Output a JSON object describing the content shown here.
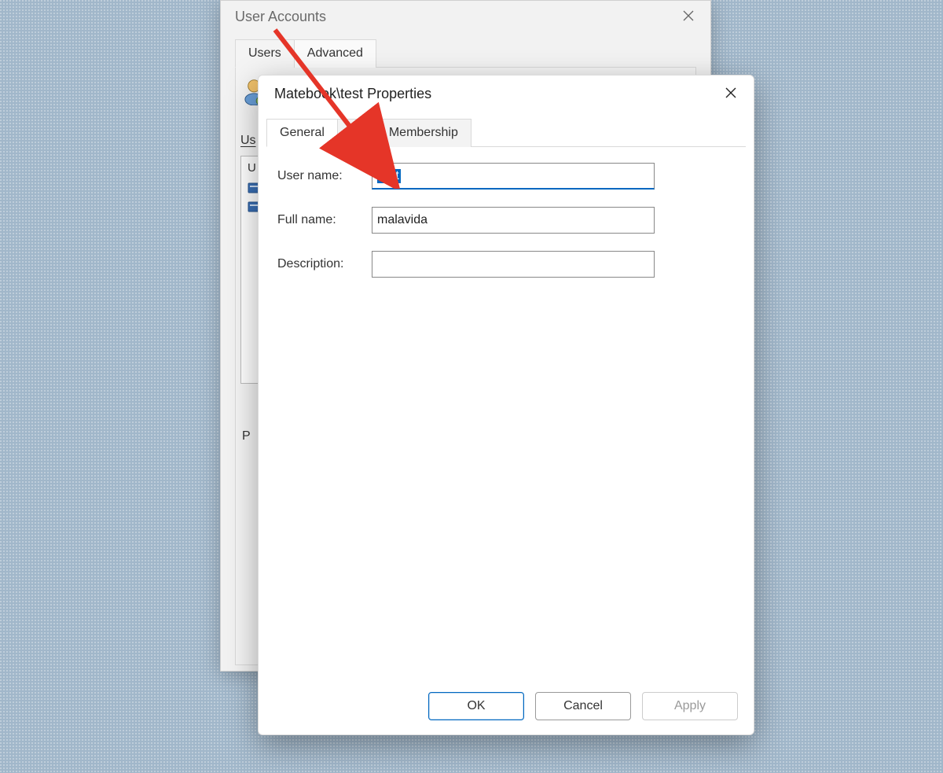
{
  "parent_window": {
    "title": "User Accounts",
    "tabs": {
      "users": "Users",
      "advanced": "Advanced"
    },
    "users_heading": "Us",
    "column_header_fragment": "U",
    "p_fragment": "P"
  },
  "child_window": {
    "title": "Matebook\\test Properties",
    "tabs": {
      "general": "General",
      "membership": "Group Membership"
    },
    "form": {
      "username_label": "User name:",
      "username_value": "test",
      "fullname_label": "Full name:",
      "fullname_value": "malavida",
      "description_label": "Description:",
      "description_value": ""
    },
    "buttons": {
      "ok": "OK",
      "cancel": "Cancel",
      "apply": "Apply"
    }
  },
  "colors": {
    "accent": "#0067c0",
    "arrow": "#e53528"
  }
}
